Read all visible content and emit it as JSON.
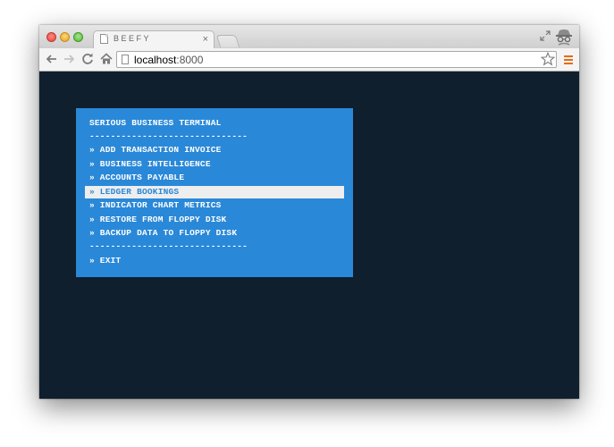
{
  "browser": {
    "tab": {
      "title": "BEEFY",
      "close_glyph": "×"
    },
    "address_bar": {
      "host": "localhost",
      "port": ":8000"
    },
    "icons": {
      "back": "back-arrow-icon",
      "forward": "forward-arrow-icon",
      "reload": "reload-icon",
      "home": "home-icon",
      "bookmark": "star-icon",
      "menu": "hamburger-menu-icon",
      "incognito": "incognito-icon",
      "fullscreen": "fullscreen-icon"
    },
    "colors": {
      "menu_accent": "#e86a1a"
    }
  },
  "terminal": {
    "title": "SERIOUS BUSINESS TERMINAL",
    "divider": "------------------------------",
    "items": [
      {
        "label": "» ADD TRANSACTION INVOICE",
        "selected": false
      },
      {
        "label": "» BUSINESS INTELLIGENCE",
        "selected": false
      },
      {
        "label": "» ACCOUNTS PAYABLE",
        "selected": false
      },
      {
        "label": "» LEDGER BOOKINGS",
        "selected": true
      },
      {
        "label": "» INDICATOR CHART METRICS",
        "selected": false
      },
      {
        "label": "» RESTORE FROM FLOPPY DISK",
        "selected": false
      },
      {
        "label": "» BACKUP DATA TO FLOPPY DISK",
        "selected": false
      }
    ],
    "exit_label": "» EXIT",
    "colors": {
      "page_background": "#0f1f2d",
      "panel_background": "#2a88d8",
      "text": "#ffffff",
      "selected_background": "#eeeeee",
      "selected_text": "#2a88d8"
    }
  }
}
